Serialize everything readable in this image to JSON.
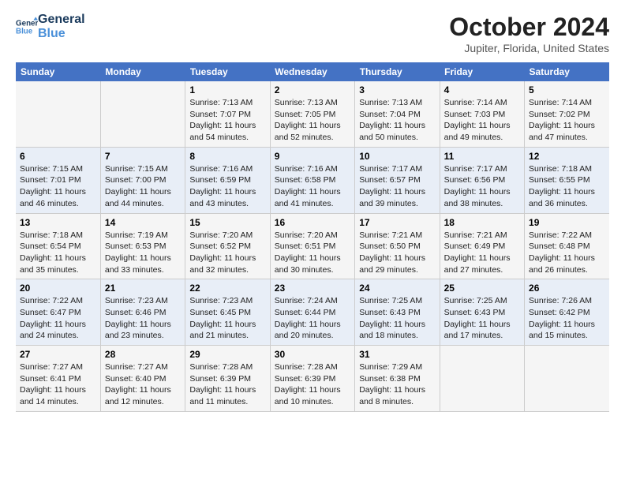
{
  "logo": {
    "line1": "General",
    "line2": "Blue"
  },
  "title": "October 2024",
  "subtitle": "Jupiter, Florida, United States",
  "header_days": [
    "Sunday",
    "Monday",
    "Tuesday",
    "Wednesday",
    "Thursday",
    "Friday",
    "Saturday"
  ],
  "weeks": [
    [
      {
        "day": "",
        "info": ""
      },
      {
        "day": "",
        "info": ""
      },
      {
        "day": "1",
        "info": "Sunrise: 7:13 AM\nSunset: 7:07 PM\nDaylight: 11 hours and 54 minutes."
      },
      {
        "day": "2",
        "info": "Sunrise: 7:13 AM\nSunset: 7:05 PM\nDaylight: 11 hours and 52 minutes."
      },
      {
        "day": "3",
        "info": "Sunrise: 7:13 AM\nSunset: 7:04 PM\nDaylight: 11 hours and 50 minutes."
      },
      {
        "day": "4",
        "info": "Sunrise: 7:14 AM\nSunset: 7:03 PM\nDaylight: 11 hours and 49 minutes."
      },
      {
        "day": "5",
        "info": "Sunrise: 7:14 AM\nSunset: 7:02 PM\nDaylight: 11 hours and 47 minutes."
      }
    ],
    [
      {
        "day": "6",
        "info": "Sunrise: 7:15 AM\nSunset: 7:01 PM\nDaylight: 11 hours and 46 minutes."
      },
      {
        "day": "7",
        "info": "Sunrise: 7:15 AM\nSunset: 7:00 PM\nDaylight: 11 hours and 44 minutes."
      },
      {
        "day": "8",
        "info": "Sunrise: 7:16 AM\nSunset: 6:59 PM\nDaylight: 11 hours and 43 minutes."
      },
      {
        "day": "9",
        "info": "Sunrise: 7:16 AM\nSunset: 6:58 PM\nDaylight: 11 hours and 41 minutes."
      },
      {
        "day": "10",
        "info": "Sunrise: 7:17 AM\nSunset: 6:57 PM\nDaylight: 11 hours and 39 minutes."
      },
      {
        "day": "11",
        "info": "Sunrise: 7:17 AM\nSunset: 6:56 PM\nDaylight: 11 hours and 38 minutes."
      },
      {
        "day": "12",
        "info": "Sunrise: 7:18 AM\nSunset: 6:55 PM\nDaylight: 11 hours and 36 minutes."
      }
    ],
    [
      {
        "day": "13",
        "info": "Sunrise: 7:18 AM\nSunset: 6:54 PM\nDaylight: 11 hours and 35 minutes."
      },
      {
        "day": "14",
        "info": "Sunrise: 7:19 AM\nSunset: 6:53 PM\nDaylight: 11 hours and 33 minutes."
      },
      {
        "day": "15",
        "info": "Sunrise: 7:20 AM\nSunset: 6:52 PM\nDaylight: 11 hours and 32 minutes."
      },
      {
        "day": "16",
        "info": "Sunrise: 7:20 AM\nSunset: 6:51 PM\nDaylight: 11 hours and 30 minutes."
      },
      {
        "day": "17",
        "info": "Sunrise: 7:21 AM\nSunset: 6:50 PM\nDaylight: 11 hours and 29 minutes."
      },
      {
        "day": "18",
        "info": "Sunrise: 7:21 AM\nSunset: 6:49 PM\nDaylight: 11 hours and 27 minutes."
      },
      {
        "day": "19",
        "info": "Sunrise: 7:22 AM\nSunset: 6:48 PM\nDaylight: 11 hours and 26 minutes."
      }
    ],
    [
      {
        "day": "20",
        "info": "Sunrise: 7:22 AM\nSunset: 6:47 PM\nDaylight: 11 hours and 24 minutes."
      },
      {
        "day": "21",
        "info": "Sunrise: 7:23 AM\nSunset: 6:46 PM\nDaylight: 11 hours and 23 minutes."
      },
      {
        "day": "22",
        "info": "Sunrise: 7:23 AM\nSunset: 6:45 PM\nDaylight: 11 hours and 21 minutes."
      },
      {
        "day": "23",
        "info": "Sunrise: 7:24 AM\nSunset: 6:44 PM\nDaylight: 11 hours and 20 minutes."
      },
      {
        "day": "24",
        "info": "Sunrise: 7:25 AM\nSunset: 6:43 PM\nDaylight: 11 hours and 18 minutes."
      },
      {
        "day": "25",
        "info": "Sunrise: 7:25 AM\nSunset: 6:43 PM\nDaylight: 11 hours and 17 minutes."
      },
      {
        "day": "26",
        "info": "Sunrise: 7:26 AM\nSunset: 6:42 PM\nDaylight: 11 hours and 15 minutes."
      }
    ],
    [
      {
        "day": "27",
        "info": "Sunrise: 7:27 AM\nSunset: 6:41 PM\nDaylight: 11 hours and 14 minutes."
      },
      {
        "day": "28",
        "info": "Sunrise: 7:27 AM\nSunset: 6:40 PM\nDaylight: 11 hours and 12 minutes."
      },
      {
        "day": "29",
        "info": "Sunrise: 7:28 AM\nSunset: 6:39 PM\nDaylight: 11 hours and 11 minutes."
      },
      {
        "day": "30",
        "info": "Sunrise: 7:28 AM\nSunset: 6:39 PM\nDaylight: 11 hours and 10 minutes."
      },
      {
        "day": "31",
        "info": "Sunrise: 7:29 AM\nSunset: 6:38 PM\nDaylight: 11 hours and 8 minutes."
      },
      {
        "day": "",
        "info": ""
      },
      {
        "day": "",
        "info": ""
      }
    ]
  ]
}
